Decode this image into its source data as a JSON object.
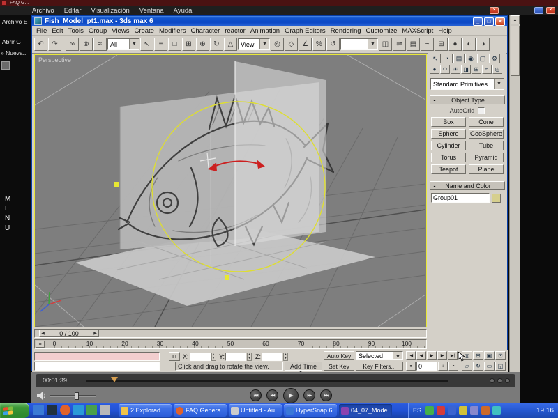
{
  "browser": {
    "title": "FAQ G...",
    "menu": [
      "Archivo",
      "Editar",
      "Visualización",
      "Ventana",
      "Ayuda"
    ],
    "sidebar_links": [
      "Archivo E",
      "Abrir G",
      "» Nueva..."
    ],
    "menu_letters": [
      "M",
      "E",
      "N",
      "U"
    ]
  },
  "max": {
    "title": "Fish_Model_pt1.max - 3ds max 6",
    "menu": [
      "File",
      "Edit",
      "Tools",
      "Group",
      "Views",
      "Create",
      "Modifiers",
      "Character",
      "reactor",
      "Animation",
      "Graph Editors",
      "Rendering",
      "Customize",
      "MAXScript",
      "Help"
    ],
    "toolbar": {
      "filter": "All",
      "coord": "View"
    },
    "viewport_label": "Perspective",
    "panel": {
      "dropdown": "Standard Primitives",
      "rollout_object_type": "Object Type",
      "autogrid": "AutoGrid",
      "prims": [
        "Box",
        "Cone",
        "Sphere",
        "GeoSphere",
        "Cylinder",
        "Tube",
        "Torus",
        "Pyramid",
        "Teapot",
        "Plane"
      ],
      "rollout_name_color": "Name and Color",
      "object_name": "Group01"
    },
    "time_slider": "0 / 100",
    "ticks": [
      "0",
      "10",
      "20",
      "30",
      "40",
      "50",
      "60",
      "70",
      "80",
      "90",
      "100"
    ],
    "status": {
      "prompt": "Click and drag to rotate the view.",
      "add_time_tag": "Add Time Tag",
      "x": "X:",
      "y": "Y:",
      "z": "Z:",
      "auto_key": "Auto Key",
      "set_key": "Set Key",
      "selected": "Selected",
      "key_filters": "Key Filters...",
      "frame": "0"
    }
  },
  "player": {
    "time": "00:01:39"
  },
  "taskbar": {
    "tasks": [
      "2 Explorad...",
      "FAQ Genera...",
      "Untitled - Au...",
      "HyperSnap 6",
      "04_07_Mode..."
    ],
    "lang": "ES",
    "clock": "19:16"
  },
  "icons": {
    "arrow_up": "▲",
    "arrow_down": "▼",
    "win_min": "_",
    "win_max": "□",
    "win_close": "×",
    "lock": "⊓",
    "toolbar": [
      "↶",
      "↷",
      "∞",
      "⊗",
      "≈",
      "↖",
      "≡",
      "□",
      "⊞",
      "⊕",
      "↻",
      "△",
      "◎",
      "◇",
      "∠",
      "%",
      "↺",
      "◫",
      "⇌",
      "▤",
      "~",
      "⊟",
      "●",
      "◐",
      "◑"
    ],
    "panel_tabs": [
      "↖",
      "◔",
      "▤",
      "◉",
      "▢",
      "⚙"
    ],
    "panel_cats": [
      "●",
      "◠",
      "☀",
      "◨",
      "⊞",
      "≈",
      "◎"
    ],
    "transport_row1": [
      "|◀",
      "◀",
      "▶",
      "▶",
      "▶|"
    ],
    "transport_row2": [
      "●",
      "↕",
      "◔"
    ],
    "nav": [
      "◎",
      "⊞",
      "▣",
      "⊡",
      "▱",
      "↻",
      "▭",
      "◱"
    ],
    "ruler_btn": "≡",
    "ts_left": "◀",
    "ts_right": "▶",
    "player_buttons": [
      "|◀◀",
      "◀◀",
      "▶",
      "▶▶",
      "▶▶|"
    ]
  },
  "colors": {
    "titlebar_blue": "#0a46c4",
    "taskbar_blue": "#2253d6",
    "start_green": "#3c9838",
    "viewport_gray": "#7e7e7e",
    "active_viewport_yellow": "#e8e838",
    "ui_gray": "#d4d0c8",
    "maxscript_pink": "#f2cece"
  }
}
